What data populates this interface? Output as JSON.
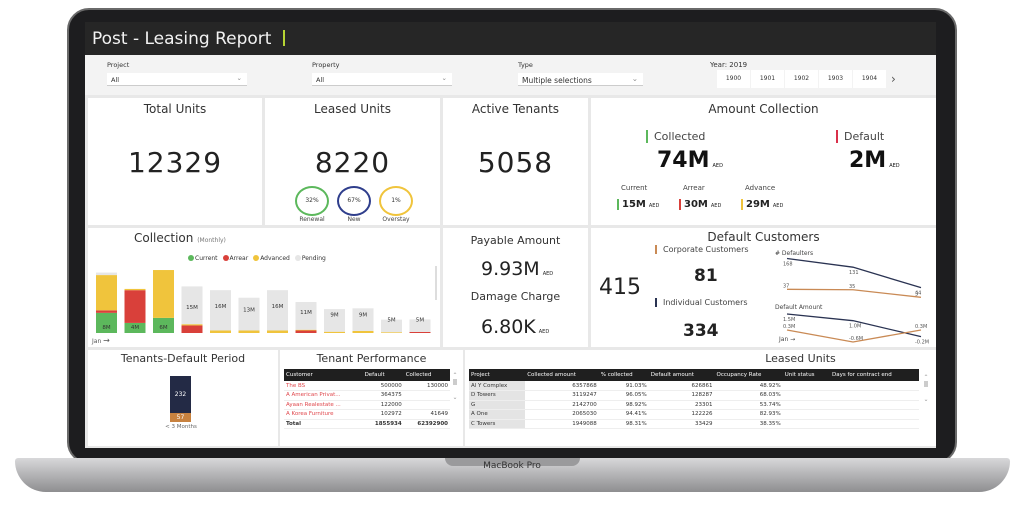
{
  "device": {
    "label": "MacBook Pro"
  },
  "header": {
    "title": "Post - Leasing Report"
  },
  "filters": {
    "project": {
      "label": "Project",
      "value": "All"
    },
    "property": {
      "label": "Property",
      "value": "All"
    },
    "type": {
      "label": "Type",
      "value": "Multiple selections"
    },
    "year": {
      "label": "Year: 2019",
      "options": [
        "1900",
        "1901",
        "1902",
        "1903",
        "1904"
      ]
    }
  },
  "total_units": {
    "title": "Total Units",
    "value": "12329"
  },
  "leased_units": {
    "title": "Leased Units",
    "value": "8220",
    "rings": [
      {
        "pct": "32%",
        "label": "Renewal",
        "color": "#5cb85c"
      },
      {
        "pct": "67%",
        "label": "New",
        "color": "#2f3e8c"
      },
      {
        "pct": "1%",
        "label": "Overstay",
        "color": "#f0c43c"
      }
    ]
  },
  "active_tenants": {
    "title": "Active Tenants",
    "value": "5058"
  },
  "amount_collection": {
    "title": "Amount Collection",
    "collected_label": "Collected",
    "collected": "74M",
    "default_label": "Default",
    "default": "2M",
    "unit": "AED",
    "breakdown": [
      {
        "label": "Current",
        "value": "15M",
        "color": "#5cb85c"
      },
      {
        "label": "Arrear",
        "value": "30M",
        "color": "#d9403a"
      },
      {
        "label": "Advance",
        "value": "29M",
        "color": "#f0c43c"
      }
    ]
  },
  "payable": {
    "title": "Payable Amount",
    "value": "9.93M",
    "damage_title": "Damage Charge",
    "damage_value": "6.80K",
    "unit": "AED"
  },
  "default_customers": {
    "title": "Default Customers",
    "total": "415",
    "corporate_label": "Corporate Customers",
    "corporate": "81",
    "individual_label": "Individual Customers",
    "individual": "334",
    "defaulters_title": "# Defaulters",
    "amount_title": "Default Amount",
    "axis_label": "Jan"
  },
  "chart_data": [
    {
      "type": "bar",
      "title": "Collection",
      "subtitle": "(Monthly)",
      "stacked": true,
      "xlabel": "Jan",
      "legend": [
        "Current",
        "Arrear",
        "Advanced",
        "Pending"
      ],
      "colors": [
        "#5cb85c",
        "#d9403a",
        "#f0c43c",
        "#e6e6e6"
      ],
      "series": [
        {
          "name": "Current",
          "values": [
            8,
            4,
            6,
            0,
            0,
            0,
            0,
            0,
            0,
            0,
            0,
            0
          ]
        },
        {
          "name": "Arrear",
          "values": [
            1,
            13,
            0,
            3,
            0,
            0,
            0,
            1,
            0,
            0,
            0,
            0.4
          ]
        },
        {
          "name": "Advanced",
          "values": [
            14,
            0.5,
            19,
            0.5,
            1,
            1,
            1,
            0.3,
            0.5,
            0.8,
            0.3,
            0
          ]
        },
        {
          "name": "Pending",
          "values": [
            1,
            0,
            0,
            15,
            16,
            13,
            16,
            11,
            9,
            9,
            5,
            5
          ]
        }
      ],
      "data_labels": [
        "8M",
        "4M",
        "6M",
        "15M",
        "16M",
        "13M",
        "16M",
        "11M",
        "9M",
        "9M",
        "5M",
        "5M"
      ],
      "ylim": [
        0,
        27
      ]
    },
    {
      "type": "line",
      "title": "# Defaulters",
      "series": [
        {
          "name": "Individual Customers",
          "values": [
            168,
            131,
            44
          ],
          "color": "#2a3352"
        },
        {
          "name": "Corporate Customers",
          "values": [
            37,
            35,
            3
          ],
          "color": "#c98a55"
        }
      ],
      "labels": [
        [
          "168",
          "131",
          "44"
        ],
        [
          "37",
          "35",
          "3"
        ]
      ]
    },
    {
      "type": "line",
      "title": "Default Amount",
      "series": [
        {
          "name": "Individual Customers",
          "values": [
            1.5,
            1.0,
            -0.2
          ],
          "color": "#2a3352"
        },
        {
          "name": "Corporate Customers",
          "values": [
            0.3,
            -0.6,
            0.3
          ],
          "color": "#c98a55"
        }
      ],
      "labels": [
        [
          "1.5M",
          "1.0M",
          "-0.2M"
        ],
        [
          "0.3M",
          "-0.6M",
          "0.3M"
        ]
      ]
    }
  ],
  "tenants_default": {
    "title": "Tenants-Default Period",
    "top": "232",
    "bottom": "57",
    "category": "< 3 Months"
  },
  "tenant_performance": {
    "title": "Tenant Performance",
    "columns": [
      "Customer",
      "Default",
      "Collected"
    ],
    "rows": [
      [
        "The BS",
        "500000",
        "130000"
      ],
      [
        "A American Privat...",
        "364375",
        ""
      ],
      [
        "Ayaan Realestate ...",
        "122000",
        ""
      ],
      [
        "A Korea Furniture",
        "102972",
        "41649"
      ]
    ],
    "total": [
      "Total",
      "1855934",
      "62392900"
    ]
  },
  "leased_table": {
    "title": "Leased Units",
    "columns": [
      "Project",
      "Collected amount",
      "% collected",
      "Default amount",
      "Occupancy Rate",
      "Unit status",
      "Days for contract end"
    ],
    "rows": [
      [
        "Al Y  Complex",
        "6357868",
        "91.03%",
        "626861",
        "48.92%",
        "",
        ""
      ],
      [
        "D Towers",
        "3119247",
        "96.05%",
        "128287",
        "68.03%",
        "",
        ""
      ],
      [
        "G",
        "2142700",
        "98.92%",
        "23301",
        "53.74%",
        "",
        ""
      ],
      [
        "A One",
        "2065030",
        "94.41%",
        "122226",
        "82.93%",
        "",
        ""
      ],
      [
        "C Towers",
        "1949088",
        "98.31%",
        "33429",
        "38.35%",
        "",
        ""
      ]
    ]
  }
}
